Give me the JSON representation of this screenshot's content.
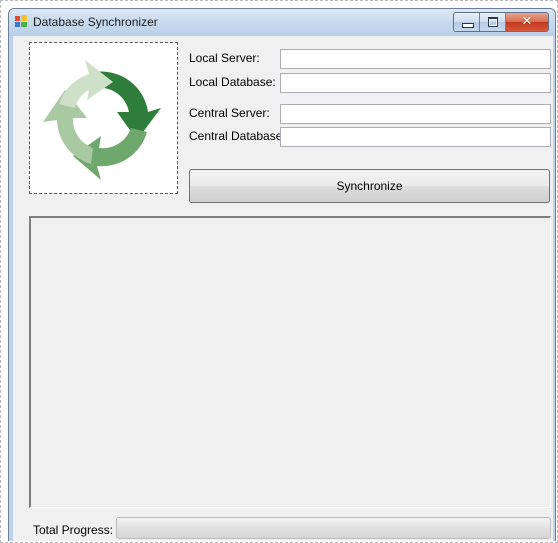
{
  "window": {
    "title": "Database Synchronizer",
    "icon": "app-windows-icon",
    "caption_buttons": [
      "minimize-icon",
      "maximize-icon",
      "close-icon"
    ],
    "close_glyph": "✕"
  },
  "form": {
    "local_server_label": "Local Server:",
    "local_database_label": "Local Database:",
    "central_server_label": "Central Server:",
    "central_database_label": "Central Database:",
    "local_server_value": "",
    "local_database_value": "",
    "central_server_value": "",
    "central_database_value": "",
    "synchronize_label": "Synchronize"
  },
  "logo": {
    "icon": "sync-cycle-arrows-icon",
    "colors": [
      "#2f7d3a",
      "#6fa86c",
      "#a9c9a2",
      "#cfe0c8"
    ]
  },
  "log": {
    "entries": []
  },
  "progress": {
    "label": "Total Progress:",
    "value": 0
  }
}
